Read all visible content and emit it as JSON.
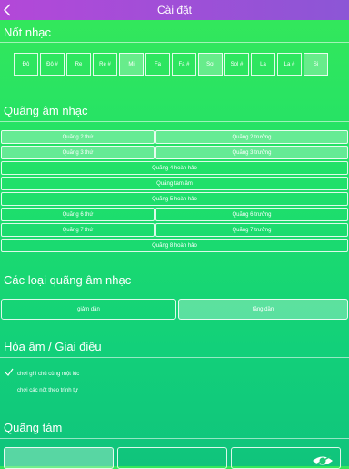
{
  "header": {
    "title": "Cài đặt"
  },
  "notes": {
    "title": "Nốt nhạc",
    "items": [
      {
        "label": "Đô",
        "selected": false
      },
      {
        "label": "Đô #",
        "selected": false
      },
      {
        "label": "Re",
        "selected": false
      },
      {
        "label": "Re #",
        "selected": false
      },
      {
        "label": "Mi",
        "selected": true
      },
      {
        "label": "Fa",
        "selected": false
      },
      {
        "label": "Fa #",
        "selected": false
      },
      {
        "label": "Sol",
        "selected": true
      },
      {
        "label": "Sol #",
        "selected": false
      },
      {
        "label": "La",
        "selected": false
      },
      {
        "label": "La #",
        "selected": false
      },
      {
        "label": "Si",
        "selected": true
      }
    ]
  },
  "intervals": {
    "title": "Quãng âm nhạc",
    "items": [
      {
        "label": "Quãng 2 thứ",
        "selected": true
      },
      {
        "label": "Quãng 2 trưởng",
        "selected": true
      },
      {
        "label": "Quãng 3 thứ",
        "selected": true
      },
      {
        "label": "Quãng 3 trưởng",
        "selected": true
      },
      {
        "label": "Quãng 4 hoàn hảo",
        "selected": false
      },
      {
        "label": "Quãng tam âm",
        "selected": false
      },
      {
        "label": "Quãng 5 hoàn hảo",
        "selected": false
      },
      {
        "label": "Quãng 6 thứ",
        "selected": false
      },
      {
        "label": "Quãng 6 trưởng",
        "selected": false
      },
      {
        "label": "Quãng 7 thứ",
        "selected": false
      },
      {
        "label": "Quãng 7 trưởng",
        "selected": false
      },
      {
        "label": "Quãng 8 hoàn hảo",
        "selected": false
      }
    ]
  },
  "interval_types": {
    "title": "Các loại quãng âm nhạc",
    "items": [
      {
        "label": "giảm dần",
        "selected": false
      },
      {
        "label": "tăng dần",
        "selected": true
      }
    ]
  },
  "harmony": {
    "title": "Hòa âm / Giai điệu",
    "options": [
      {
        "label": "chơi ghi chú cùng một lúc",
        "checked": true
      },
      {
        "label": "chơi các nốt theo trình tự",
        "checked": false
      }
    ]
  },
  "octave": {
    "title": "Quãng tám",
    "items": [
      {
        "selected": true
      },
      {
        "selected": false
      },
      {
        "selected": false,
        "icon": "eye-icon"
      }
    ]
  },
  "colors": {
    "header_start": "#b348d8",
    "header_end": "#8c56d6",
    "background_top": "#35e85a",
    "background_bottom": "#10c47c"
  }
}
